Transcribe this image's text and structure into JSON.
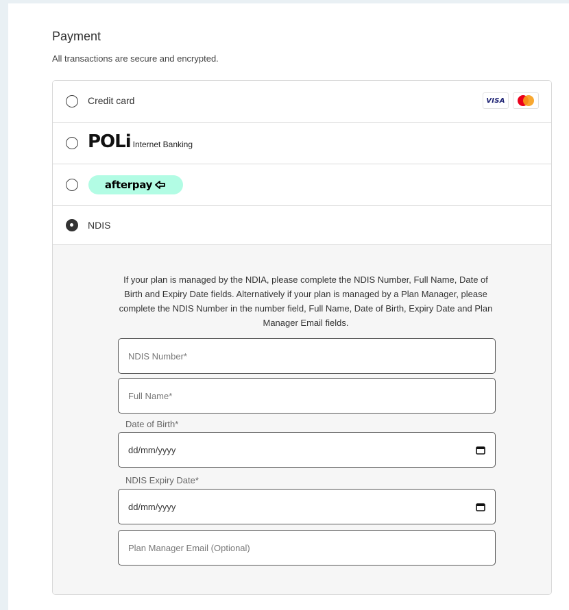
{
  "payment": {
    "title": "Payment",
    "subtitle": "All transactions are secure and encrypted."
  },
  "methods": {
    "credit_card": {
      "label": "Credit card",
      "selected": false,
      "card_brands": [
        "VISA",
        "Mastercard"
      ],
      "visa_text": "VISA"
    },
    "poli": {
      "logo_text": "POLi",
      "sub_label": "Internet Banking",
      "selected": false
    },
    "afterpay": {
      "logo_text": "afterpay",
      "badge_color": "#b2fce4",
      "selected": false
    },
    "ndis": {
      "label": "NDIS",
      "selected": true
    }
  },
  "ndis_form": {
    "info": "If your plan is managed by the NDIA, please complete the NDIS Number, Full Name, Date of Birth and Expiry Date fields. Alternatively if your plan is managed by a Plan Manager, please complete the NDIS Number in the number field, Full Name, Date of Birth, Expiry Date and Plan Manager Email fields.",
    "ndis_number": {
      "placeholder": "NDIS Number*",
      "value": ""
    },
    "full_name": {
      "placeholder": "Full Name*",
      "value": ""
    },
    "date_of_birth": {
      "label": "Date of Birth*",
      "placeholder": "dd/mm/yyyy"
    },
    "expiry_date": {
      "label": "NDIS Expiry Date*",
      "placeholder": "dd/mm/yyyy"
    },
    "plan_manager_email": {
      "placeholder": "Plan Manager Email (Optional)",
      "value": ""
    }
  },
  "icons": {
    "calendar": "calendar-icon",
    "afterpay_arrows": "afterpay-arrows-icon",
    "mastercard": "mastercard-icon"
  }
}
